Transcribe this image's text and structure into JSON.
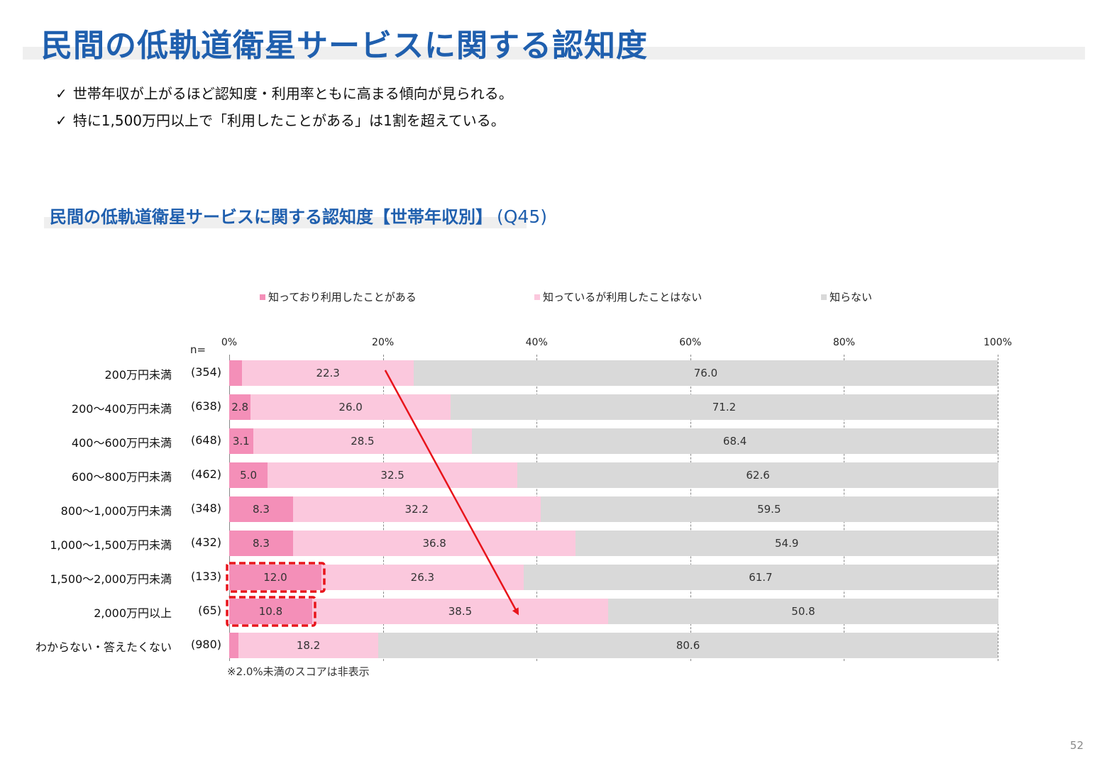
{
  "page": {
    "title": "民間の低軌道衛星サービスに関する認知度",
    "bullets": [
      "世帯年収が上がるほど認知度・利用率ともに高まる傾向が見られる。",
      "特に1,500万円以上で「利用したことがある」は1割を超えている。"
    ],
    "check_icon": "✓",
    "page_number": "52"
  },
  "chart_data": {
    "type": "bar",
    "orientation": "horizontal-stacked-100",
    "title": "民間の低軌道衛星サービスに関する認知度【世帯年収別】",
    "question_code": "(Q45)",
    "n_label": "n=",
    "xlim": [
      0,
      100
    ],
    "x_ticks": [
      "0%",
      "20%",
      "40%",
      "60%",
      "80%",
      "100%"
    ],
    "legend_position": "top",
    "categories": [
      "200万円未満",
      "200～400万円未満",
      "400～600万円未満",
      "600～800万円未満",
      "800～1,000万円未満",
      "1,000～1,500万円未満",
      "1,500～2,000万円未満",
      "2,000万円以上",
      "わからない・答えたくない"
    ],
    "n_values": [
      "(354)",
      "(638)",
      "(648)",
      "(462)",
      "(348)",
      "(432)",
      "(133)",
      "(65)",
      "(980)"
    ],
    "series": [
      {
        "name": "知っており利用したことがある",
        "color": "#f48fb8",
        "values": [
          1.7,
          2.8,
          3.1,
          5.0,
          8.3,
          8.3,
          12.0,
          10.8,
          1.2
        ],
        "labels": [
          "",
          "2.8",
          "3.1",
          "5.0",
          "8.3",
          "8.3",
          "12.0",
          "10.8",
          ""
        ]
      },
      {
        "name": "知っているが利用したことはない",
        "color": "#fbc8dd",
        "values": [
          22.3,
          26.0,
          28.5,
          32.5,
          32.2,
          36.8,
          26.3,
          38.5,
          18.2
        ],
        "labels": [
          "22.3",
          "26.0",
          "28.5",
          "32.5",
          "32.2",
          "36.8",
          "26.3",
          "38.5",
          "18.2"
        ]
      },
      {
        "name": "知らない",
        "color": "#d9d9d9",
        "values": [
          76.0,
          71.2,
          68.4,
          62.6,
          59.5,
          54.9,
          61.7,
          50.8,
          80.6
        ],
        "labels": [
          "76.0",
          "71.2",
          "68.4",
          "62.6",
          "59.5",
          "54.9",
          "61.7",
          "50.8",
          "80.6"
        ]
      }
    ],
    "highlighted_rows": [
      6,
      7
    ],
    "highlight_color": "#e8141b",
    "trend_arrow": {
      "from": {
        "row": 0,
        "x": 20.3
      },
      "to": {
        "row": 7,
        "x": 37.5
      },
      "color": "#e8141b"
    },
    "footnote": "※2.0%未満のスコアは非表示",
    "grid": true
  }
}
